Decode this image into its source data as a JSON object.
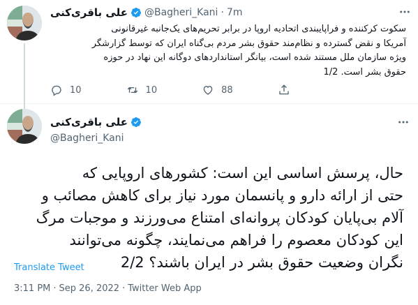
{
  "tweet1": {
    "name": "علی باقری‌کنی",
    "handle": "@Bagheri_Kani",
    "time": "7m",
    "text_lines": [
      "سکوت کرکننده و فراپایبندی اتحادیه اروپا در برابر تحریم‌های یک‌جانبه غیرقانونی",
      "آمریکا و نقض گسترده و نظام‌مند حقوق بشر مردم بی‌گناه ایران که توسط گزارشگر",
      "ویژه سازمان ملل مستند شده است، بیانگر استانداردهای دوگانه این نهاد در حوزه",
      "حقوق بشر است. 1/2"
    ],
    "replies": "10",
    "retweets": "10",
    "likes": "88"
  },
  "tweet2": {
    "name": "علی باقری‌کنی",
    "handle": "@Bagheri_Kani",
    "text_lines": [
      "حال، پرسش اساسی این است: کشورهای اروپایی که",
      "حتی از ارائه دارو و پانسمان مورد نیاز برای کاهش مصائب و",
      "آلام بی‌پایان کودکان پروانه‌ای امتناع می‌ورزند و موجبات مرگ",
      "این کودکان معصوم را فراهم می‌نمایند، چگونه می‌توانند",
      "نگران وضعیت حقوق بشر در ایران باشند؟ 2/2"
    ],
    "translate_label": "Translate Tweet",
    "time": "3:11 PM",
    "date": "Sep 26, 2022",
    "source": "Twitter Web App",
    "separator": "·"
  },
  "colors": {
    "accent": "#1d9bf0",
    "secondary_text": "#536471",
    "divider": "#eff3f4"
  }
}
